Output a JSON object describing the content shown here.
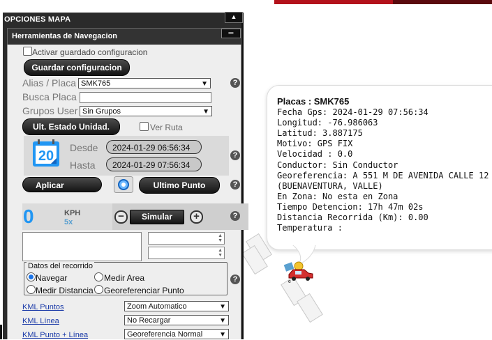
{
  "panel": {
    "title": "OPCIONES MAPA",
    "collapse_icon": "▲",
    "section_title": "Herramientas de Navegacion",
    "minimize_icon": "−"
  },
  "settings": {
    "save_checkbox_label": "Activar guardado configuracion",
    "save_button": "Guardar configuracion"
  },
  "filters": {
    "alias_label": "Alias / Placa",
    "alias_value": "SMK765",
    "busca_label": "Busca Placa",
    "busca_value": "",
    "grupos_label": "Grupos User",
    "grupos_value": "Sin Grupos"
  },
  "status": {
    "ult_estado_button": "Ult. Estado Unidad.",
    "ver_ruta_label": "Ver Ruta"
  },
  "dates": {
    "calendar_day": "20",
    "desde_label": "Desde",
    "desde_value": "2024-01-29 06:56:34",
    "hasta_label": "Hasta",
    "hasta_value": "2024-01-29 07:56:34"
  },
  "actions": {
    "aplicar": "Aplicar",
    "ultimo_punto": "Ultimo Punto"
  },
  "simulation": {
    "speed": "0",
    "unit": "KPH",
    "multiplier": "5x",
    "simular": "Simular"
  },
  "recorrido": {
    "legend": "Datos del recorrido",
    "navegar": "Navegar",
    "medir_area": "Medir Area",
    "medir_distancia": "Medir Distancia",
    "georeferenciar": "Georeferenciar Punto",
    "selected": "Navegar"
  },
  "kml": [
    {
      "link": "KML Puntos",
      "select": "Zoom Automatico"
    },
    {
      "link": "KML Línea",
      "select": "No Recargar"
    },
    {
      "link": "KML Punto + Línea",
      "select": "Georeferencia Normal"
    }
  ],
  "help_icon": "?",
  "info": {
    "placas_label": "Placas : SMK765",
    "fecha": "Fecha Gps: 2024-01-29 07:56:34",
    "longitud": "Longitud: -76.986063",
    "latitud": "Latitud: 3.887175",
    "motivo": "Motivo: GPS FIX",
    "velocidad": "Velocidad : 0.0",
    "conductor": "Conductor: Sin Conductor",
    "georeferencia": "Georeferencia: A 551 M DE AVENIDA CALLE 12",
    "georeferencia2": "(BUENAVENTURA, VALLE)",
    "zona": "En Zona: No esta en Zona",
    "detencion": "Tiempo Detencion: 17h 47m 02s",
    "distancia": "Distancia Recorrida (Km): 0.00",
    "temperatura": "Temperatura :"
  },
  "colors": {
    "accent_blue": "#2196f3",
    "top_red": "#b3121b",
    "panel_dark": "#2b2b2b",
    "vehicle_red": "#d32f2f"
  }
}
